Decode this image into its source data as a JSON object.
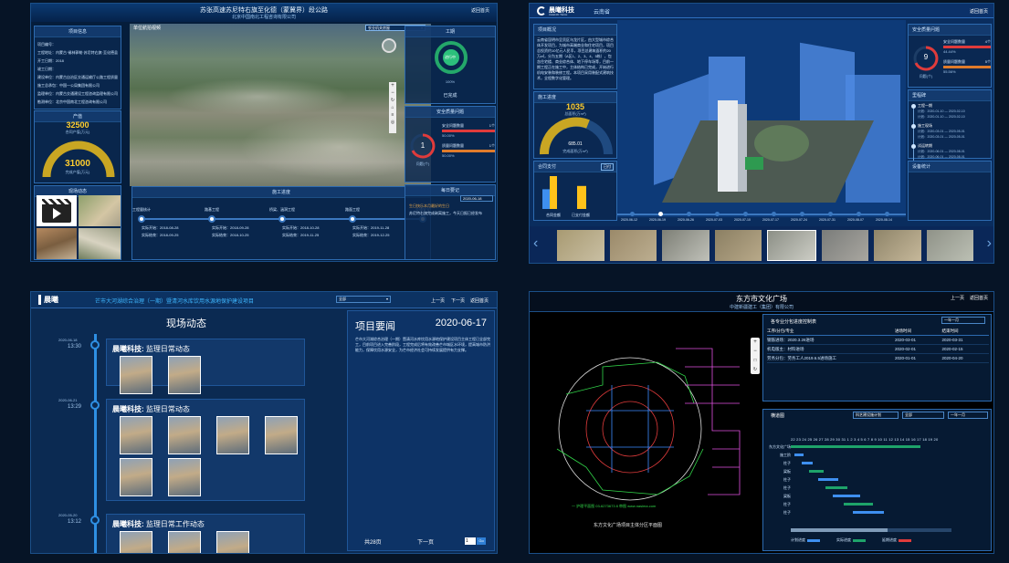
{
  "p1": {
    "title": "苏张高速苏尼特右旗至化德（蒙冀界）段公路",
    "subtitle": "北京中国南北工程咨询有限公司",
    "return_label": "返回首页",
    "info_title": "项目信息",
    "info_lines": [
      "项目编号：",
      "工程地址：内蒙古·锡林郭勒·苏尼特右旗·至化德县交",
      "开工日期：2018",
      "竣工日期：",
      "建设单位：内蒙古自治区交通运输厅公路工程质量局",
      "施工总承包：中国一公局集团有限公司",
      "监理单位：内蒙古交通建设工程咨询监理有限公司",
      "勘测单位：北京中国南北工程咨询有限公司"
    ],
    "output_title": "产值",
    "output_big": "32500",
    "output_big_label": "合同产值(万元)",
    "output_value": "31000",
    "output_value_label": "完成产值(万元)",
    "video_title": "现场动态",
    "map_title": "单位航拍视频",
    "map_select": "农业机关房屋",
    "work_title": "工期",
    "work_status": "进行中",
    "work_progress": "100%",
    "work_label": "已完成",
    "safety_title": "安全质量问题",
    "safety_count": "1",
    "safety_circle_label": "问题(个)",
    "safety_lines": [
      {
        "label": "安全问题数量",
        "value": "1个",
        "pct": "50.00%"
      },
      {
        "label": "质量问题数量",
        "value": "1个",
        "pct": "50.00%"
      }
    ],
    "construct_title": "施工进度",
    "stages": [
      "工程量核计",
      "路基工程",
      "桥梁、涵洞工程",
      "路面工程",
      "交通安全"
    ],
    "stage_starts": [
      "实际开始：2018-08-28",
      "实际开始：2018-09-28",
      "实际开始：2018-10-28",
      "实际开始：2019-11-28"
    ],
    "stage_ends": [
      "实际结束：2018-09-25",
      "实际结束：2018-10-25",
      "实际结束：2019-11-25",
      "实际结束：2019-12-25"
    ],
    "daily_title": "每日要记",
    "daily_date": "2020-06-18",
    "daily_text_1": "生日快乐本月最好的生日",
    "daily_text_2": "苏尼特右旗完成剥离施工，今天日报已经发布"
  },
  "p2": {
    "logo_text": "晨曦科技",
    "logo_sub": "CHENXI TECH",
    "nav_label": "云南省",
    "return_label": "返回首页",
    "overview_title": "项目概况",
    "overview_text": "云南省昆明市呈贡区乌龙片区，由大型城市综合体开发项目，为城市高端商业和住宅项目，项目总投资约10亿元人民币，项目总建筑面积约20万㎡，分为五期（A区1、2、3、4、5栋），包含住宅楼、商业综合体、地下停车场等，目前一期工程正在施工中，主体结构已完成，开始进行机电安装和装修工程。本项目采用装配式建筑技术，全程数字化管理。",
    "progress_title": "施工进度",
    "progress_value": "1035",
    "progress_value_label": "总面积(万m²)",
    "progress_done": "685.01",
    "progress_done_label": "完成面积(万m²)",
    "contract_title": "合同支付",
    "contract_tag": "已付",
    "bar_labels": [
      "合同金额",
      "已支付金额"
    ],
    "bar_values": [
      100,
      70
    ],
    "safety_title": "安全质量问题",
    "safety_count": "9",
    "safety_circle_label": "问题(个)",
    "safety_lines": [
      {
        "label": "安全问题数量",
        "value": "4个",
        "pct": "44.44%"
      },
      {
        "label": "质量问题数量",
        "value": "5个",
        "pct": "55.56%"
      }
    ],
    "milestone_title": "里程碑",
    "milestones": [
      {
        "name": "工程一期",
        "date": "计划：2020-01-10 — 2020-02-10"
      },
      {
        "name": "施工现场",
        "date": "计划：2020-03-01 — 2020-05-01"
      },
      {
        "name": "试运转期",
        "date": "计划：2020-06-01 — 2020-08-01"
      }
    ],
    "device_title": "设备统计",
    "timeline_dates": [
      "2020-06-12",
      "2020-06-19",
      "2020-06-26",
      "2020-07-03",
      "2020-07-10",
      "2020-07-17",
      "2020-07-24",
      "2020-07-31",
      "2020-08-07",
      "2020-08-14",
      "2020-08-21",
      "2020-08-28",
      "2020-09-04",
      "2020-09-11"
    ]
  },
  "p3": {
    "logo_text": "晨曦",
    "title": "芒市大河湖综合治理（一期）暨清河水库饮用水源地保护建设项目",
    "select_label": "全部",
    "prev_label": "上一页",
    "next_label": "下一页",
    "return_label": "返回首页",
    "feed_title": "现场动态",
    "feed_items": [
      {
        "date": "2020-06-18",
        "time": "13:30",
        "author": "晨曦科技:",
        "text": " 监理日常动态"
      },
      {
        "date": "2020-06-21",
        "time": "13:29",
        "author": "晨曦科技:",
        "text": " 监理日常动态"
      },
      {
        "date": "2020-05-20",
        "time": "13:12",
        "author": "晨曦科技:",
        "text": " 监理日常工作动态"
      }
    ],
    "news_title": "项目要闻",
    "news_date": "2020-06-17",
    "news_text": "芒市大河湖综合治理（一期）暨清河水库饮用水源地保护建设项目主体工程已全部完工，目前项目进入完善阶段，工程完成后将有效改善芒市城区水环境，提高城市防洪能力，保障饮用水源安全，为芒市经济社会可持续发展提供有力支撑。",
    "pager_total": "共28页",
    "pager_next": "下一页",
    "pager_input": "1",
    "pager_go": "Go"
  },
  "p4": {
    "title": "东方市文化广场",
    "subtitle": "中建新疆建工（集团）有限公司",
    "prev_label": "上一页",
    "return_label": "返回首页",
    "drawing_caption": "东方文化广场项目主体分区平面图",
    "drawing_caption2": "一 护理平面图 03-6273673 8 审图 www.nasima.com",
    "table_title": "各专业分包进度控制表",
    "table_select": "一年一月",
    "table_headers": [
      "工序/分包/专业",
      "进场时间",
      "结束时间"
    ],
    "table_rows": [
      [
        "钢筋进场：2020.3.26进场",
        "2020-03-01",
        "2020-03-31"
      ],
      [
        "机电版主：材料进场",
        "2020-02-01",
        "2020-02-15"
      ],
      [
        "劳务分包：劳务工人2019.6.5进场施工",
        "2020-01-01",
        "2020-04-20"
      ]
    ],
    "gantt_title": "横道图",
    "gantt_select1": "科艺建设施计划",
    "gantt_select2": "全部",
    "gantt_select3": "一年一月",
    "gantt_days": "22 23 24 25 26 27 28 29 30 31 1 2 3 4 5 6 7 8 9 10 11 12 13 14 15 16 17 18 19 20",
    "gantt_rows": [
      "东方文化广场",
      "施工阶",
      "柱子",
      "梁板",
      "柱子",
      "柱子",
      "梁板",
      "柱子",
      "柱子"
    ],
    "legend": [
      "计划进度",
      "实际进度",
      "延期进度"
    ]
  }
}
